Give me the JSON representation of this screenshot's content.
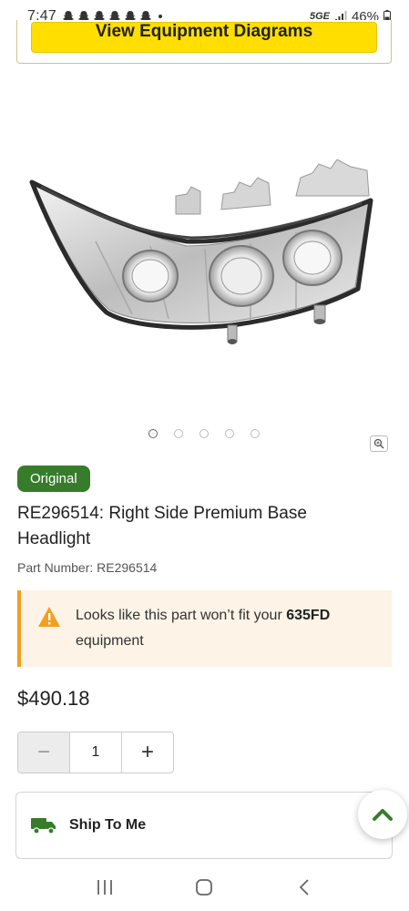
{
  "status_bar": {
    "time": "7:47",
    "network": "5GE",
    "battery": "46%"
  },
  "header": {
    "diagrams_button_label": "View Equipment Diagrams"
  },
  "product": {
    "image_icon": "headlight-image",
    "carousel_total": 5,
    "carousel_active": 0,
    "badge": "Original",
    "title": "RE296514: Right Side Premium Base Headlight",
    "part_number": "Part Number: RE296514",
    "warning": {
      "prefix": "Looks like this part won’t fit your ",
      "equipment": "635FD",
      "suffix": "equipment"
    },
    "price": "$490.18",
    "quantity": {
      "value": "1",
      "minus": "−",
      "plus": "+"
    },
    "shipping_option": "Ship To Me"
  },
  "colors": {
    "brand_green": "#367c2b",
    "brand_yellow": "#ffde00",
    "warning_orange": "#f0a020",
    "warning_bg": "#fdf3e6"
  }
}
